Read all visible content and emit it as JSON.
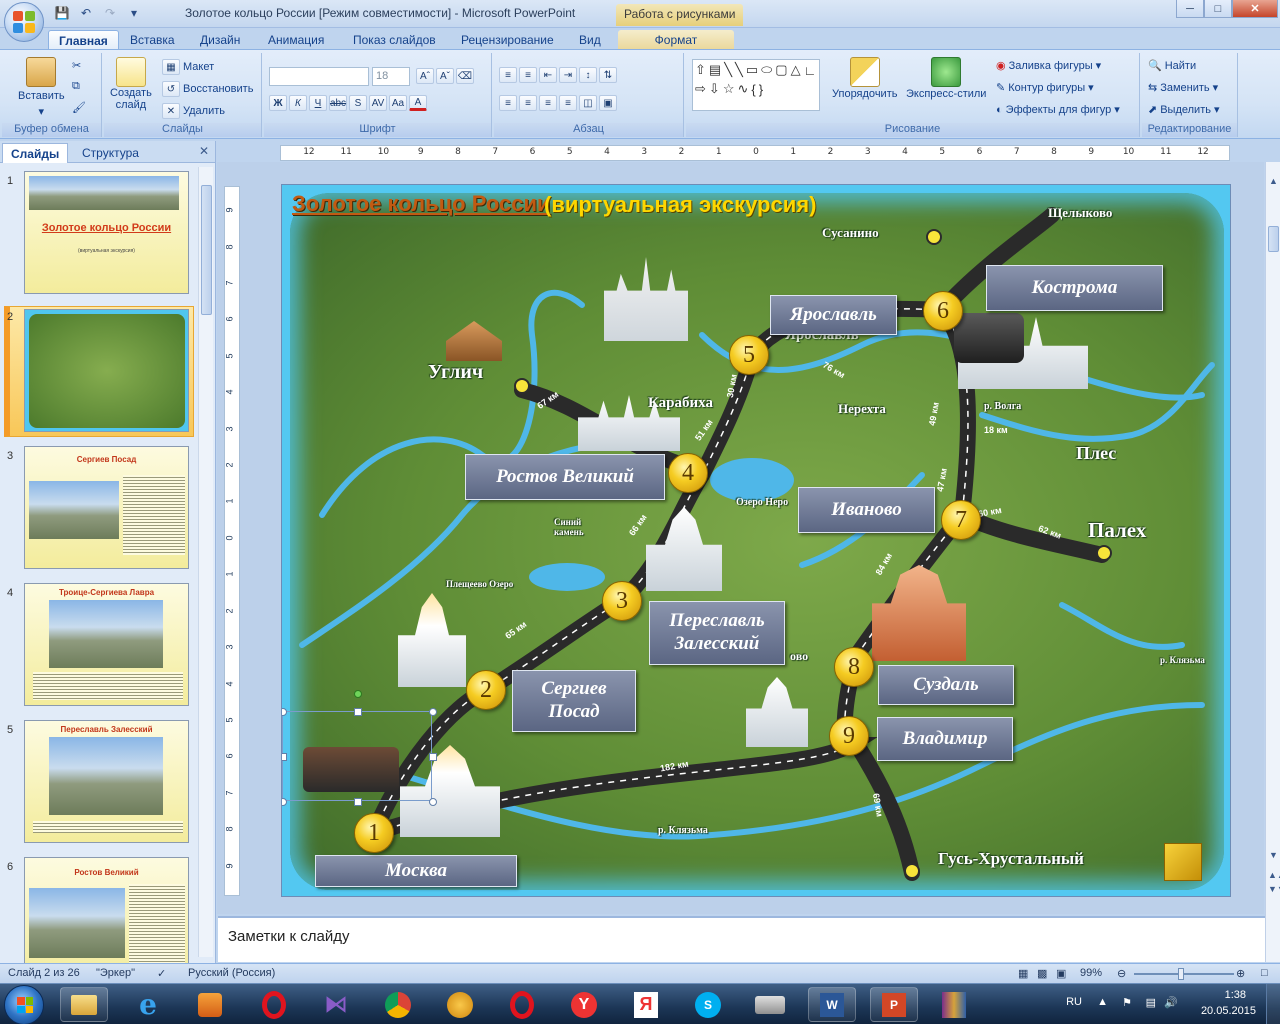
{
  "window": {
    "title": "Золотое кольцо России [Режим совместимости] - Microsoft PowerPoint",
    "context_title": "Работа с рисунками"
  },
  "tabs": [
    "Главная",
    "Вставка",
    "Дизайн",
    "Анимация",
    "Показ слайдов",
    "Рецензирование",
    "Вид",
    "Формат"
  ],
  "ribbon": {
    "clipboard": {
      "paste": "Вставить",
      "label": "Буфер обмена"
    },
    "slides": {
      "create": "Создать",
      "create2": "слайд",
      "layout": "Макет",
      "reset": "Восстановить",
      "delete": "Удалить",
      "label": "Слайды"
    },
    "font": {
      "size": "18",
      "label": "Шрифт"
    },
    "paragraph": {
      "label": "Абзац"
    },
    "drawing": {
      "arrange": "Упорядочить",
      "quickstyles": "Экспресс-стили",
      "fill": "Заливка фигуры",
      "outline": "Контур фигуры",
      "effects": "Эффекты для фигур",
      "label": "Рисование"
    },
    "editing": {
      "find": "Найти",
      "replace": "Заменить",
      "select": "Выделить",
      "label": "Редактирование"
    }
  },
  "leftpane": {
    "tab_slides": "Слайды",
    "tab_outline": "Структура",
    "thumbs": [
      {
        "num": "1",
        "title": "Золотое кольцо России",
        "sub": "(виртуальная экскурсия)"
      },
      {
        "num": "2",
        "title": ""
      },
      {
        "num": "3",
        "title": "Сергиев Посад"
      },
      {
        "num": "4",
        "title": "Троице-Сергиева Лавра"
      },
      {
        "num": "5",
        "title": "Переславль Залесский"
      },
      {
        "num": "6",
        "title": "Ростов Великий"
      }
    ]
  },
  "ruler": {
    "h_ticks": [
      "12",
      "11",
      "10",
      "9",
      "8",
      "7",
      "6",
      "5",
      "4",
      "3",
      "2",
      "1",
      "0",
      "1",
      "2",
      "3",
      "4",
      "5",
      "6",
      "7",
      "8",
      "9",
      "10",
      "11",
      "12"
    ],
    "v_ticks": [
      "9",
      "8",
      "7",
      "6",
      "5",
      "4",
      "3",
      "2",
      "1",
      "0",
      "1",
      "2",
      "3",
      "4",
      "5",
      "6",
      "7",
      "8",
      "9"
    ]
  },
  "slide": {
    "title": "Золотое кольцо России",
    "subtitle": "(виртуальная экскурсия)",
    "cities": [
      {
        "num": "1",
        "name": "Москва"
      },
      {
        "num": "2",
        "name": "Сергиев Посад"
      },
      {
        "num": "3",
        "name": "Переславль Залесский"
      },
      {
        "num": "4",
        "name": "Ростов Великий"
      },
      {
        "num": "5",
        "name": "Ярославль"
      },
      {
        "num": "6",
        "name": "Кострома"
      },
      {
        "num": "7",
        "name": "Иваново"
      },
      {
        "num": "8",
        "name": "Суздаль"
      },
      {
        "num": "9",
        "name": "Владимир"
      }
    ],
    "map_labels": {
      "uglich": "Углич",
      "karabiha": "Карабиха",
      "nerekhta": "Нерехта",
      "ples": "Плес",
      "palekh": "Палех",
      "susanino": "Сусанино",
      "shchelykovo": "Щелыково",
      "gus": "Гусь-Хрустальный",
      "ozero_nero": "Озеро Неро",
      "volga": "р. Волга",
      "klyazma": "р. Клязьма",
      "sinii_kamen": "Синий камень",
      "pleshcheevo": "Плещеево Озеро",
      "yaroslavl_map": "Ярославль",
      "klyazma2": "р. Клязьма",
      "bovo": "ово"
    },
    "distances": [
      "67 км",
      "65 км",
      "66 км",
      "51 км",
      "76 км",
      "49 км",
      "18 км",
      "47 км",
      "62 км",
      "84 км",
      "182 км",
      "69 км",
      "30 км",
      "60 км"
    ]
  },
  "notes_placeholder": "Заметки к слайду",
  "status": {
    "slide": "Слайд 2 из 26",
    "theme": "\"Эркер\"",
    "lang": "Русский (Россия)",
    "zoom": "99%"
  },
  "tray": {
    "lang": "RU",
    "time": "1:38",
    "date": "20.05.2015"
  }
}
